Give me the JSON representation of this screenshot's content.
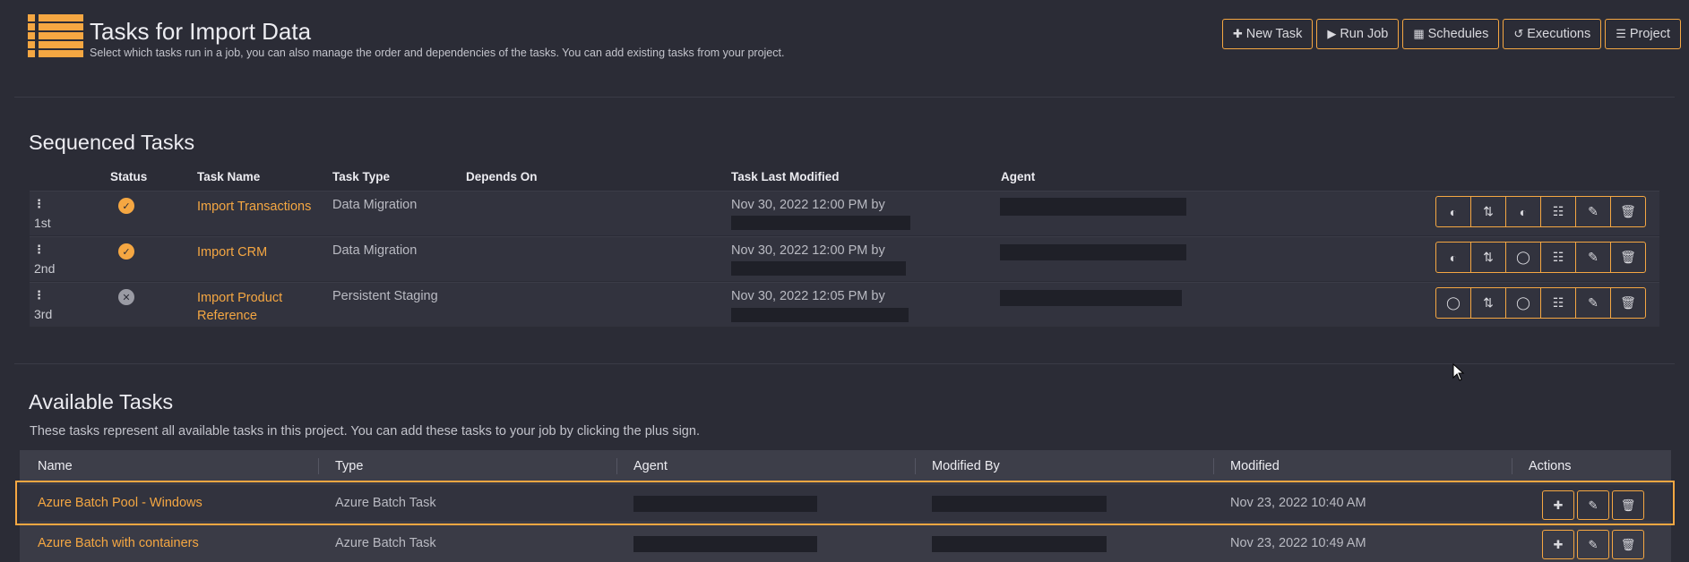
{
  "header": {
    "title": "Tasks for Import Data",
    "subtitle": "Select which tasks run in a job, you can also manage the order and dependencies of the tasks. You can add existing tasks from your project.",
    "buttons": [
      {
        "icon": "plus-icon",
        "glyph": "✚",
        "label": "New Task"
      },
      {
        "icon": "play-icon",
        "glyph": "▶",
        "label": "Run Job"
      },
      {
        "icon": "calendar-icon",
        "glyph": "▦",
        "label": "Schedules"
      },
      {
        "icon": "history-icon",
        "glyph": "↺",
        "label": "Executions"
      },
      {
        "icon": "bars-icon",
        "glyph": "☰",
        "label": "Project"
      }
    ]
  },
  "sequenced": {
    "title": "Sequenced Tasks",
    "columns": {
      "status": "Status",
      "task_name": "Task Name",
      "task_type": "Task Type",
      "depends_on": "Depends On",
      "last_modified": "Task Last Modified",
      "agent": "Agent"
    },
    "rows": [
      {
        "order": "1st",
        "status": "success",
        "name": "Import Transactions",
        "type": "Data Migration",
        "modified": "Nov 30, 2022 12:00 PM by"
      },
      {
        "order": "2nd",
        "status": "success",
        "name": "Import CRM",
        "type": "Data Migration",
        "modified": "Nov 30, 2022 12:00 PM by"
      },
      {
        "order": "3rd",
        "status": "error",
        "name": "Import Product Reference",
        "type": "Persistent Staging",
        "modified": "Nov 30, 2022 12:05 PM by"
      }
    ]
  },
  "available": {
    "title": "Available Tasks",
    "description": "These tasks represent all available tasks in this project. You can add these tasks to your job by clicking the plus sign.",
    "columns": {
      "name": "Name",
      "type": "Type",
      "agent": "Agent",
      "modified_by": "Modified By",
      "modified": "Modified",
      "actions": "Actions"
    },
    "rows": [
      {
        "name": "Azure Batch Pool - Windows",
        "type": "Azure Batch Task",
        "modified": "Nov 23, 2022 10:40 AM"
      },
      {
        "name": "Azure Batch with containers",
        "type": "Azure Batch Task",
        "modified": "Nov 23, 2022 10:49 AM"
      }
    ]
  },
  "colors": {
    "accent": "#f5a742",
    "background": "#2b2c36",
    "row_background": "#32333e",
    "redaction": "#1f2028"
  }
}
